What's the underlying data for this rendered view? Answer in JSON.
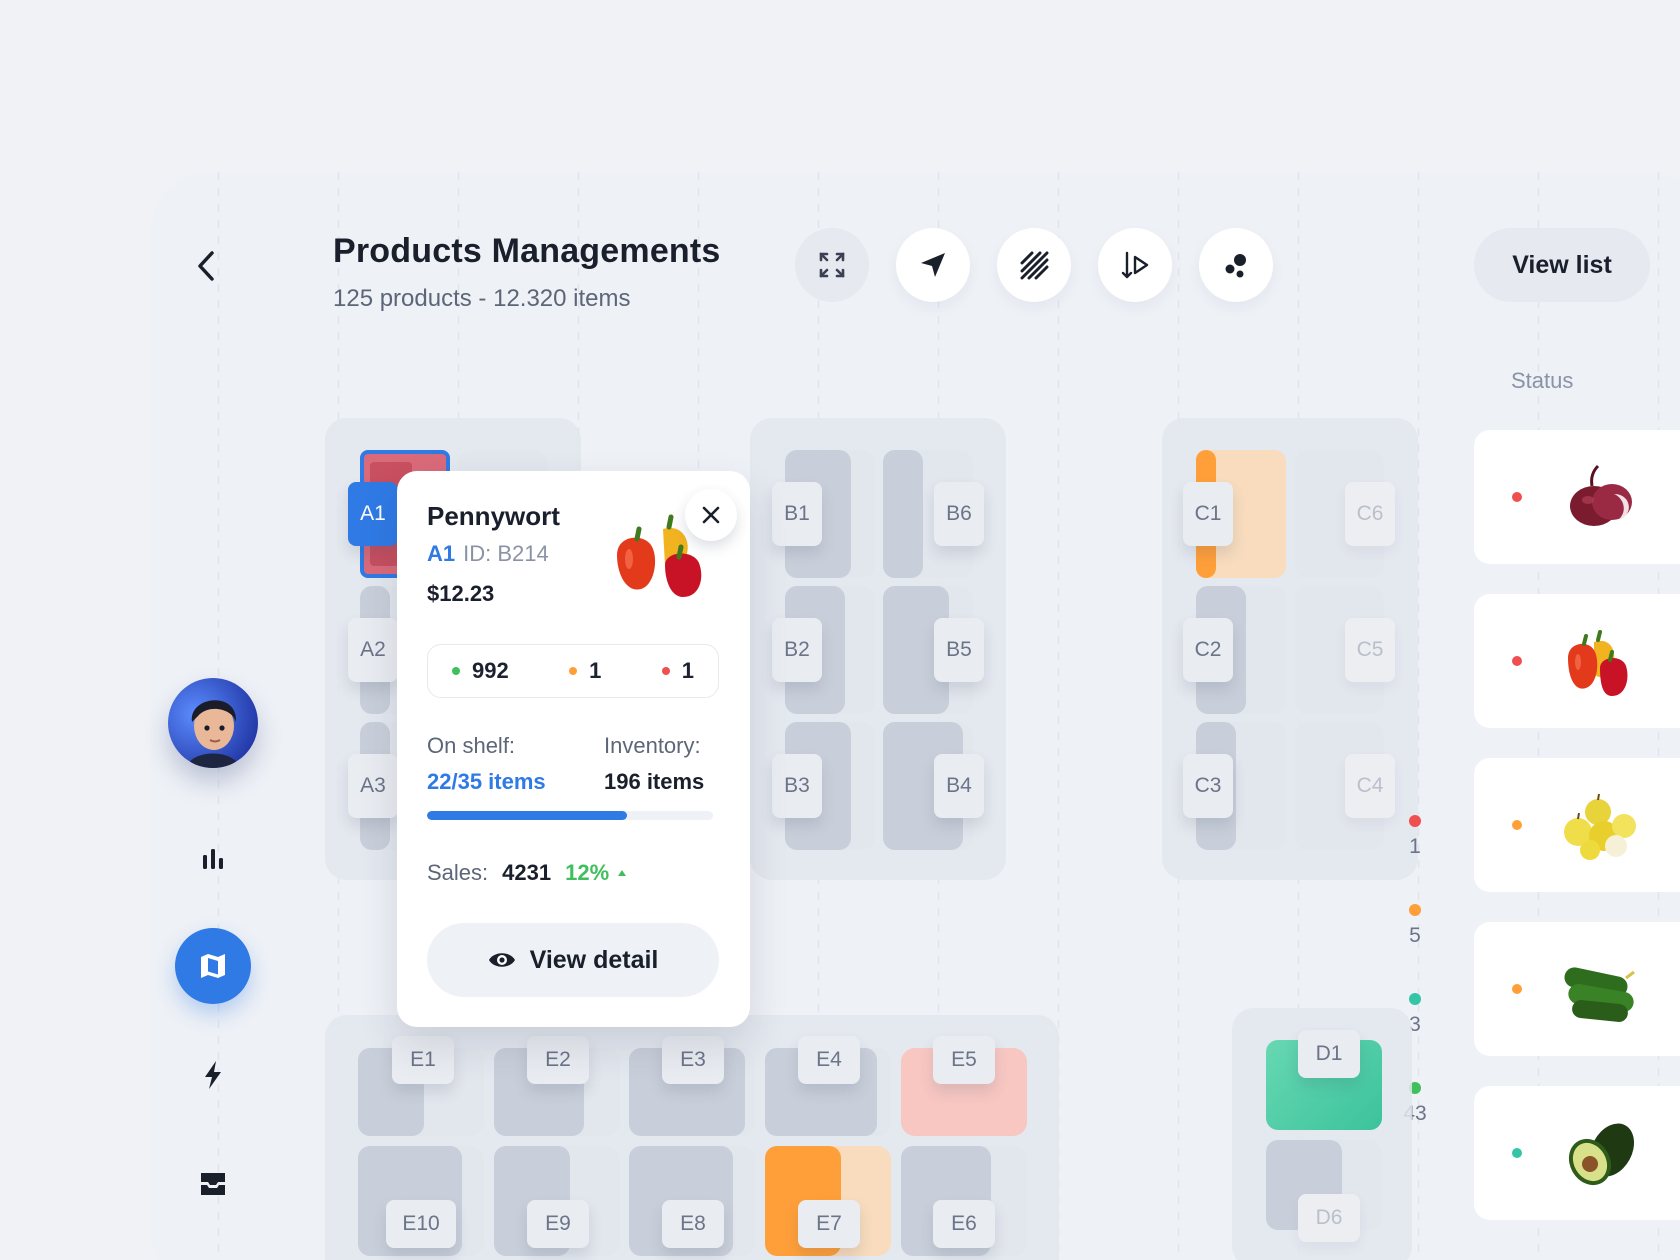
{
  "header": {
    "title": "Products Managements",
    "subtitle": "125 products - 12.320 items",
    "view_list_label": "View list",
    "tools": [
      "expand-icon",
      "navigate-icon",
      "hatch-pattern-icon",
      "route-icon",
      "cluster-icon"
    ]
  },
  "status": {
    "header": "Status"
  },
  "zones": {
    "a": [
      "A1",
      "A2",
      "A3"
    ],
    "b": [
      "B1",
      "B2",
      "B3",
      "B4",
      "B5",
      "B6"
    ],
    "c": [
      "C1",
      "C2",
      "C3",
      "C4",
      "C5",
      "C6"
    ],
    "e": [
      "E1",
      "E2",
      "E3",
      "E4",
      "E5",
      "E6",
      "E7",
      "E8",
      "E9",
      "E10"
    ],
    "d": [
      "D1",
      "D6"
    ]
  },
  "legend": [
    {
      "color": "#ef4f4f",
      "count": "1"
    },
    {
      "color": "#ff9f3a",
      "count": "5"
    },
    {
      "color": "#35c4a6",
      "count": "3"
    },
    {
      "color": "#3fbf5d",
      "count": "43"
    }
  ],
  "status_items": [
    {
      "product": "red-onion",
      "color": "#ef4f4f"
    },
    {
      "product": "bell-peppers",
      "color": "#ef4f4f"
    },
    {
      "product": "yellow-apples",
      "color": "#ff9f3a"
    },
    {
      "product": "cucumbers",
      "color": "#ff9f3a"
    },
    {
      "product": "avocado",
      "color": "#35c4a6"
    }
  ],
  "popup": {
    "name": "Pennywort",
    "location": "A1",
    "id": "ID: B214",
    "price": "$12.23",
    "stock": {
      "green": "992",
      "orange": "1",
      "red": "1"
    },
    "on_shelf_label": "On shelf:",
    "on_shelf_value": "22/35 items",
    "inventory_label": "Inventory:",
    "inventory_value": "196 items",
    "progress": 0.7,
    "sales_label": "Sales:",
    "sales_value": "4231",
    "sales_change": "12%",
    "detail_label": "View detail"
  },
  "colors": {
    "accent": "#2f7ae5",
    "green": "#3fbf5d",
    "orange": "#ff9f3a",
    "red": "#ef4f4f",
    "teal": "#35c4a6"
  }
}
